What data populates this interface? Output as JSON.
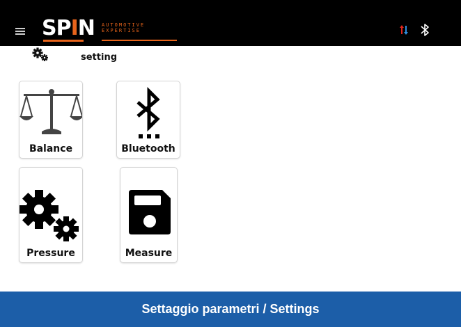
{
  "topbar": {
    "menu_icon": "hamburger-menu-icon",
    "logo": {
      "name_prefix": "SP",
      "name_i": "I",
      "name_suffix": "N",
      "tagline_line1": "AUTOMOTIVE",
      "tagline_line2": "EXPERTISE"
    },
    "status_icons": [
      "sync-arrows-icon",
      "bluetooth-icon"
    ]
  },
  "settings_header": {
    "icon": "gears-icon",
    "label": "setting"
  },
  "tiles": [
    {
      "label": "Balance",
      "icon": "balance-scale-icon"
    },
    {
      "label": "Bluetooth",
      "icon": "bluetooth-icon"
    },
    {
      "label": "Pressure",
      "icon": "gears-icon"
    },
    {
      "label": "Measure",
      "icon": "floppy-disk-icon"
    }
  ],
  "footer": {
    "title": "Settaggio parametri / Settings"
  },
  "colors": {
    "topbar_bg": "#000000",
    "brand_orange": "#e8641b",
    "footer_bg": "#1c5ea8",
    "sync_up": "#e0241b",
    "sync_down": "#2f8fe0"
  }
}
